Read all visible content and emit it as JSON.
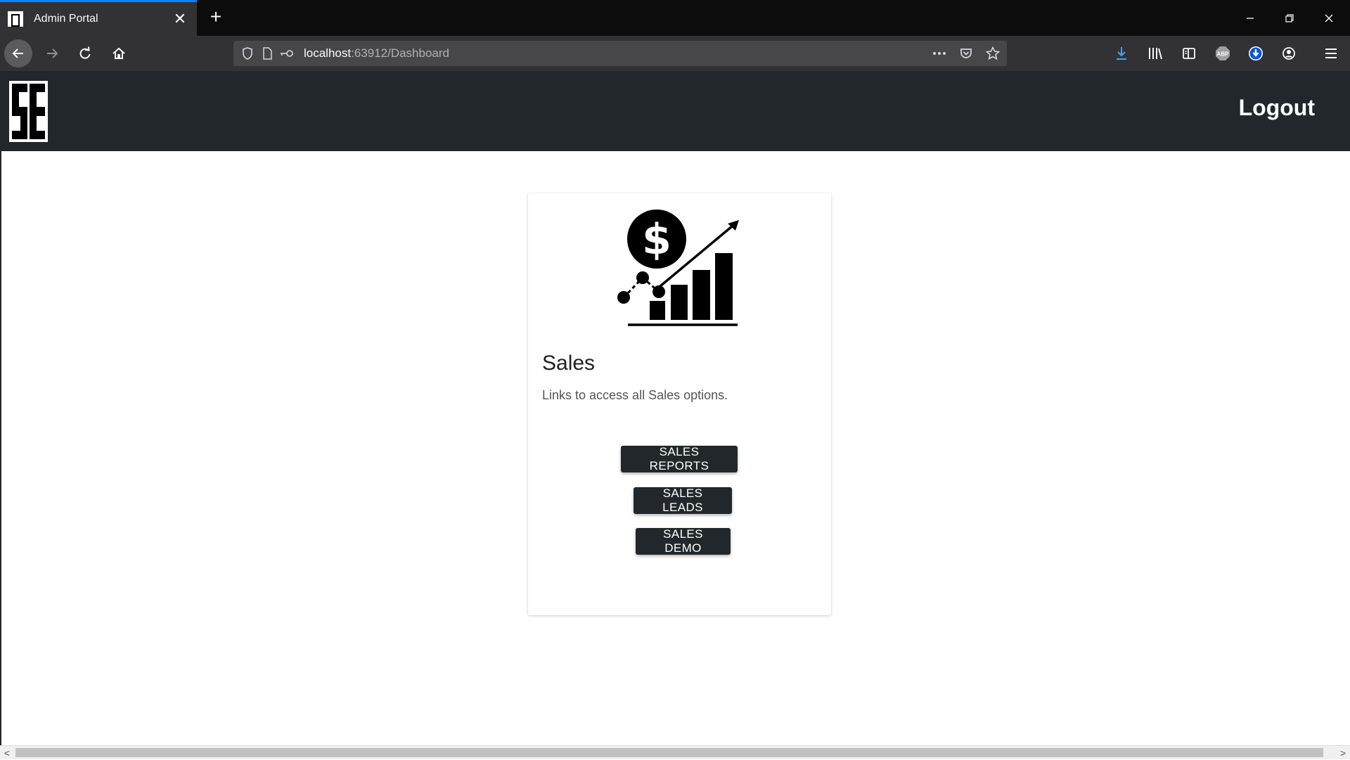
{
  "browser": {
    "tab_title": "Admin Portal",
    "tab_close": "✕",
    "new_tab": "+",
    "url_host": "localhost",
    "url_rest": ":63912/Dashboard",
    "window_controls": [
      "minimize-icon",
      "restore-icon",
      "close-icon"
    ],
    "toolbar_icons": [
      "back-arrow-icon",
      "forward-arrow-icon",
      "reload-icon",
      "home-icon"
    ],
    "urlbar_icons": [
      "shield-icon",
      "page-icon",
      "key-icon",
      "more-icon",
      "pocket-icon",
      "star-icon"
    ],
    "right_icons": [
      "download-icon",
      "library-icon",
      "sidebar-icon",
      "abp-icon",
      "extension-icon",
      "account-icon",
      "menu-icon"
    ],
    "colors": {
      "tab_accent": "#0a84ff",
      "download_icon": "#45a1ff"
    }
  },
  "site": {
    "logo_text": "SE",
    "logout_label": "Logout",
    "header_color": "#22272b"
  },
  "card": {
    "illustration": "sales-growth-chart-icon",
    "title": "Sales",
    "description": "Links to access all Sales options.",
    "buttons": {
      "reports": "SALES REPORTS",
      "leads": "SALES LEADS",
      "demo": "SALES DEMO"
    }
  },
  "scrollbar": {
    "left_arrow": "<",
    "right_arrow": ">"
  }
}
